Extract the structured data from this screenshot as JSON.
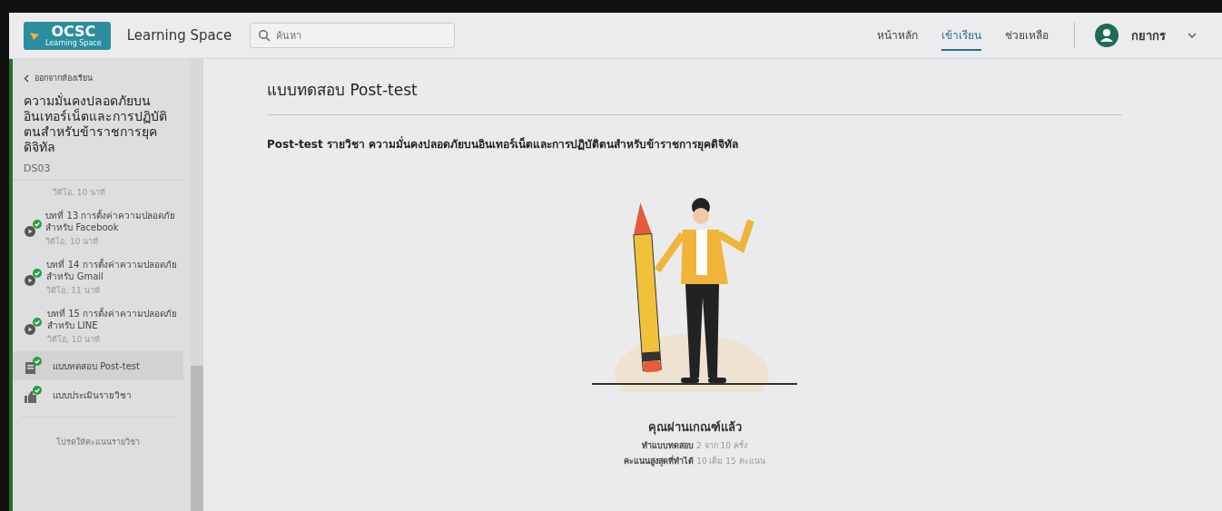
{
  "header": {
    "logo": {
      "text": "OCSC",
      "subtext": "Learning Space"
    },
    "site_name": "Learning Space",
    "search": {
      "placeholder": "ค้นหา"
    },
    "nav": [
      {
        "label": "หน้าหลัก",
        "selected": false
      },
      {
        "label": "เข้าเรียน",
        "selected": true
      },
      {
        "label": "ช่วยเหลือ",
        "selected": false
      }
    ],
    "user": {
      "name": "กยากร"
    }
  },
  "sidebar": {
    "back": "ออกจากห้องเรียน",
    "course_title": "ความมั่นคงปลอดภัยบนอินเทอร์เน็ตและการปฏิบัติตนสำหรับข้าราชการยุคดิจิทัล",
    "course_code": "DS03",
    "items": [
      {
        "kind": "partial",
        "duration": "วิดีโอ, 10 นาที",
        "selected": false
      },
      {
        "kind": "video",
        "title": "บทที่ 13 การตั้งค่าความปลอดภัยสำหรับ Facebook",
        "duration": "วิดีโอ, 10 นาที",
        "completed": true,
        "selected": false
      },
      {
        "kind": "video",
        "title": "บทที่ 14 การตั้งค่าความปลอดภัยสำหรับ Gmail",
        "duration": "วิดีโอ, 11 นาที",
        "completed": true,
        "selected": false
      },
      {
        "kind": "video",
        "title": "บทที่ 15 การตั้งค่าความปลอดภัยสำหรับ LINE",
        "duration": "วิดีโอ, 10 นาที",
        "completed": true,
        "selected": false
      },
      {
        "kind": "quiz",
        "title": "แบบทดสอบ Post-test",
        "completed": true,
        "selected": true
      },
      {
        "kind": "survey",
        "title": "แบบประเมินรายวิชา",
        "completed": true,
        "selected": false
      }
    ],
    "footer_note": "โปรดให้คะแนนรายวิชา"
  },
  "main": {
    "title": "แบบทดสอบ Post-test",
    "subtitle": "Post-test รายวิชา ความมั่นคงปลอดภัยบนอินเทอร์เน็ตและการปฏิบัติตนสำหรับข้าราชการยุคดิจิทัล",
    "result": "คุณผ่านเกณฑ์แล้ว",
    "stats": [
      "**ทำแบบทดสอบ** 2 จาก 10 ครั้ง",
      "**คะแนนสูงสุดที่ทำได้** 10 เต็ม 15 คะแนน"
    ]
  }
}
